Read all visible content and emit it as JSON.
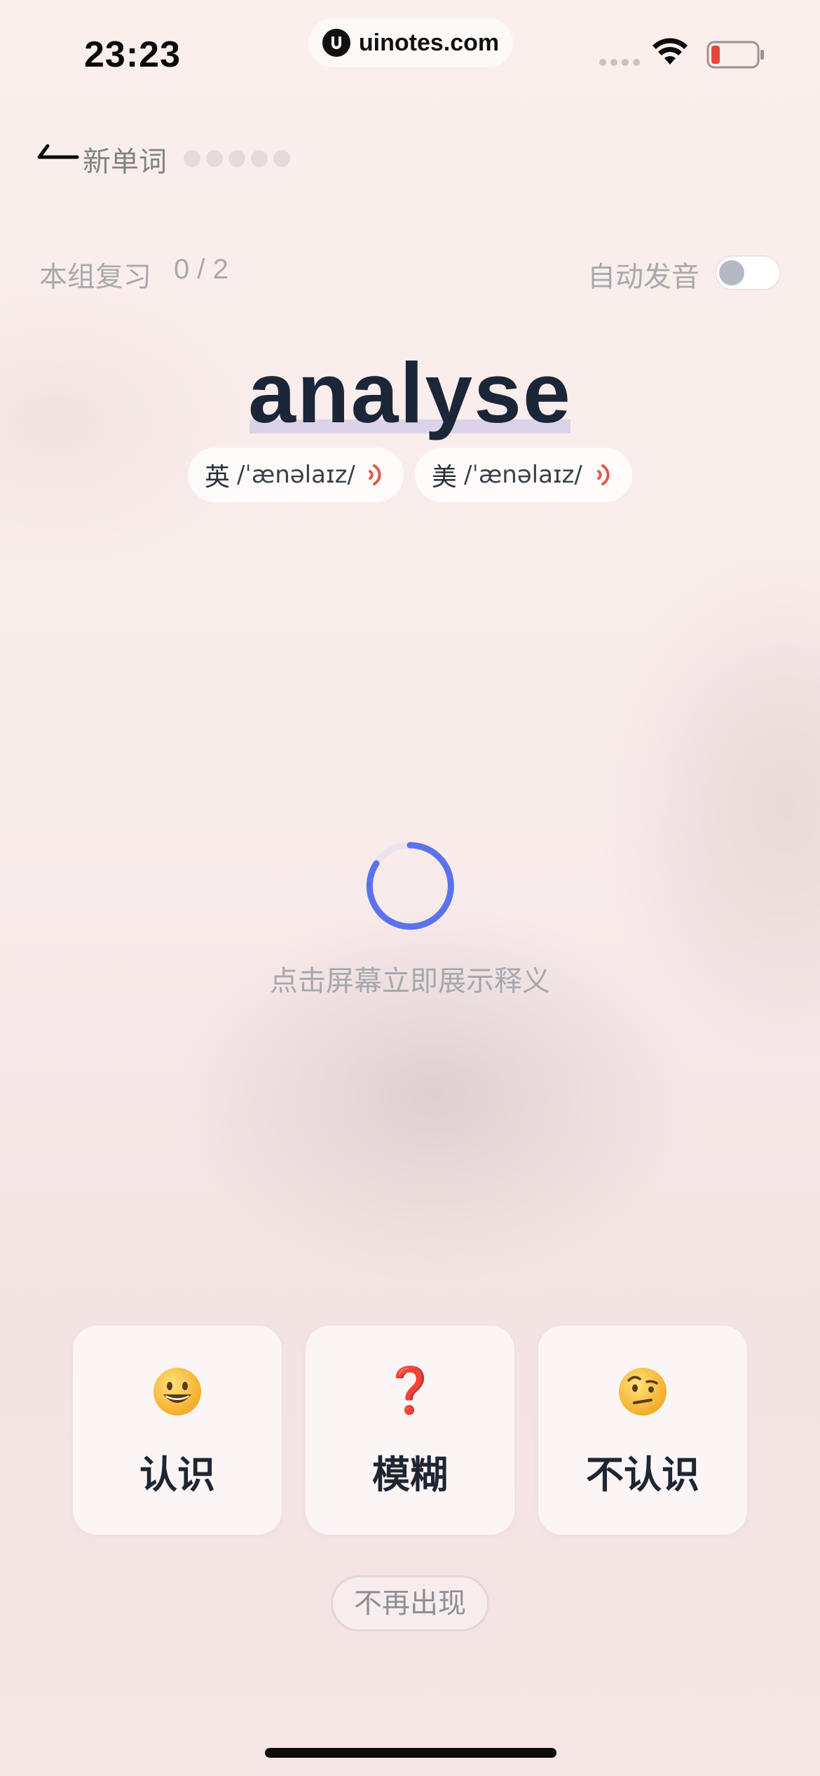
{
  "status_bar": {
    "time": "23:23",
    "url": "uinotes.com",
    "battery_color": "#e9463b"
  },
  "nav": {
    "title": "新单词",
    "progress_total": 5,
    "progress_done": 0
  },
  "review": {
    "label": "本组复习",
    "count": "0 / 2",
    "auto_play_label": "自动发音",
    "auto_play_on": false
  },
  "word": {
    "text": "analyse",
    "uk_region": "英",
    "uk_ipa": "/ˈænəlaɪz/",
    "us_region": "美",
    "us_ipa": "/ˈænəlaɪz/"
  },
  "loading": {
    "hint": "点击屏幕立即展示释义",
    "accent": "#5b73ea"
  },
  "answers": {
    "know": "认识",
    "fuzzy_icon": "❓",
    "fuzzy": "模糊",
    "unknown": "不认识"
  },
  "never_show": "不再出现"
}
